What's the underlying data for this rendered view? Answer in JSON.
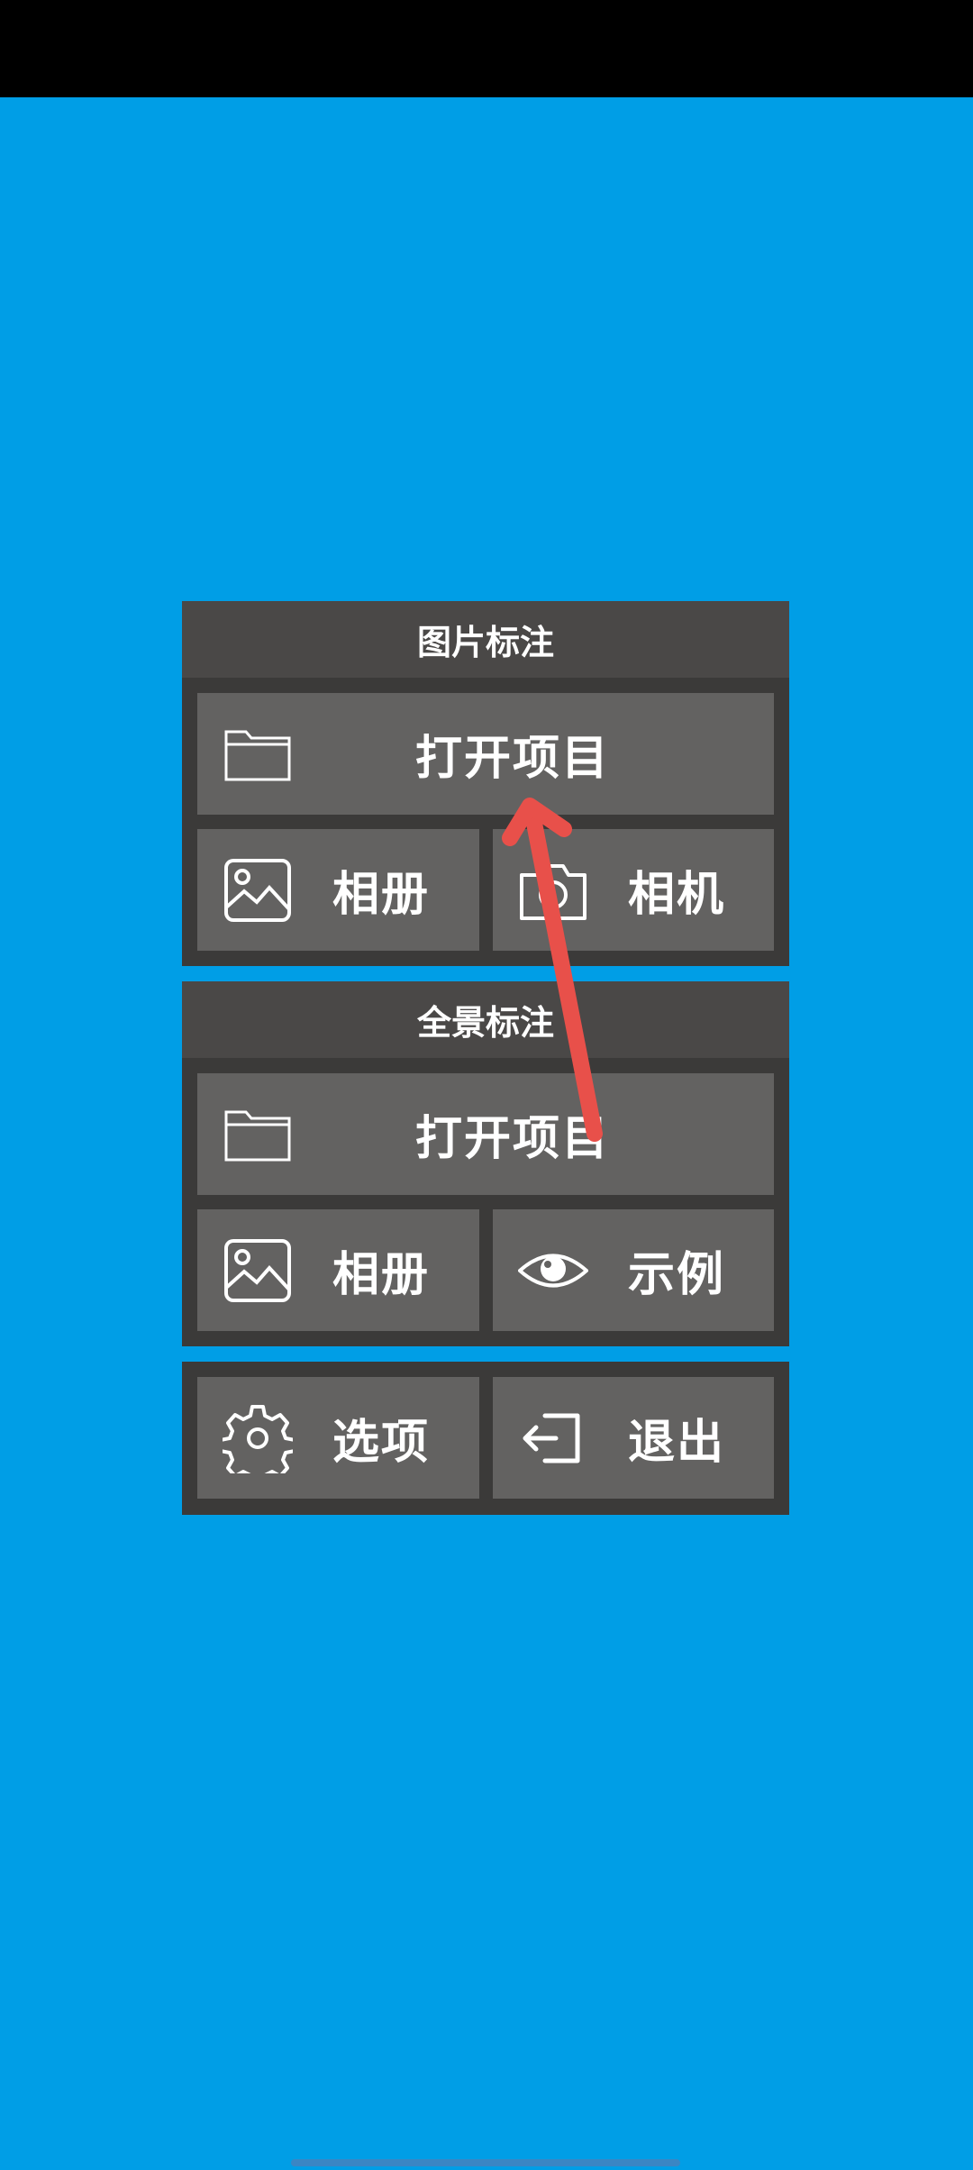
{
  "image_section": {
    "title": "图片标注",
    "open_project": "打开项目",
    "album": "相册",
    "camera": "相机"
  },
  "panorama_section": {
    "title": "全景标注",
    "open_project": "打开项目",
    "album": "相册",
    "example": "示例"
  },
  "bottom_section": {
    "options": "选项",
    "exit": "退出"
  },
  "icons": [
    "folder-icon",
    "image-icon",
    "camera-icon",
    "eye-icon",
    "gear-icon",
    "exit-icon"
  ],
  "colors": {
    "background": "#009EE6",
    "panel": "#3B3A39",
    "header": "#4A4847",
    "button": "#636261",
    "gesture_arrow": "#E8504A"
  }
}
